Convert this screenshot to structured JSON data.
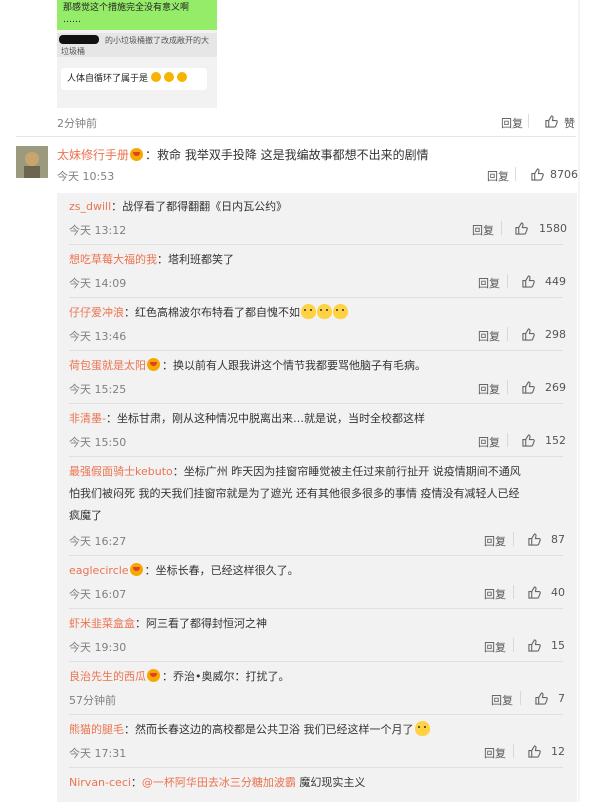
{
  "chat_image": {
    "line1": "那感觉这个措施完全没有意义啊",
    "line1b": "……",
    "gray_text": "的小垃圾桶撤了改成敞开的大垃圾桶",
    "white_text": "人体自循环了属于是"
  },
  "top_meta": {
    "time": "2分钟前",
    "reply_label": "回复",
    "like_label": "赞"
  },
  "main_comment": {
    "name": "太妹修行手册",
    "text": "：救命 我举双手投降 这是我编故事都想不出来的剧情",
    "time": "今天 10:53",
    "reply_label": "回复",
    "likes": "8706"
  },
  "replies": [
    {
      "name": "zs_dwill",
      "text": "：战俘看了都得翻翻《日内瓦公约》",
      "time": "今天 13:12",
      "reply_label": "回复",
      "likes": "1580"
    },
    {
      "name": "想吃草莓大福的我",
      "text": "：塔利班都笑了",
      "time": "今天 14:09",
      "reply_label": "回复",
      "likes": "449"
    },
    {
      "name": "仔仔爱冲浪",
      "text": "：红色高棉波尔布特看了都自愧不如",
      "time": "今天 13:46",
      "reply_label": "回复",
      "likes": "298"
    },
    {
      "name": "荷包蛋就是太阳",
      "text": "：换以前有人跟我讲这个情节我都要骂他脑子有毛病。",
      "time": "今天 15:25",
      "reply_label": "回复",
      "likes": "269"
    },
    {
      "name": "非清墨-",
      "text": "：坐标甘肃，刚从这种情况中脱离出来…就是说，当时全校都这样",
      "time": "今天 15:50",
      "reply_label": "回复",
      "likes": "152"
    },
    {
      "name": "最强假面骑士kebuto",
      "text_line1": "：坐标广州 昨天因为挂窗帘睡觉被主任过来前行扯开 说疫情期间不通风",
      "text_line2": "怕我们被闷死 我的天我们挂窗帘就是为了遮光 还有其他很多很多的事情 疫情没有减轻人已经",
      "text_line3": "疯魔了",
      "time": "今天 16:27",
      "reply_label": "回复",
      "likes": "87"
    },
    {
      "name": "eaglecircle",
      "text": "：坐标长春，已经这样很久了。",
      "time": "今天 16:07",
      "reply_label": "回复",
      "likes": "40"
    },
    {
      "name": "虾米韭菜盒盒",
      "text": "：阿三看了都得封恒河之神",
      "time": "今天 19:30",
      "reply_label": "回复",
      "likes": "15"
    },
    {
      "name": "良治先生的西瓜",
      "text": "：乔治•奥威尔：打扰了。",
      "time": "57分钟前",
      "reply_label": "回复",
      "likes": "7"
    },
    {
      "name": "熊猫的腿毛",
      "text": "：然而长春这边的高校都是公共卫浴 我们已经这样一个月了",
      "time": "今天 17:31",
      "reply_label": "回复",
      "likes": "12"
    },
    {
      "name": "Nirvan-ceci",
      "mention": "@一杯阿华田去冰三分糖加波霸",
      "text": " 魔幻现实主义"
    }
  ],
  "colors": {
    "name": "#eb7350",
    "mention": "#eb7350",
    "panel_bg": "#f2f2f2"
  }
}
